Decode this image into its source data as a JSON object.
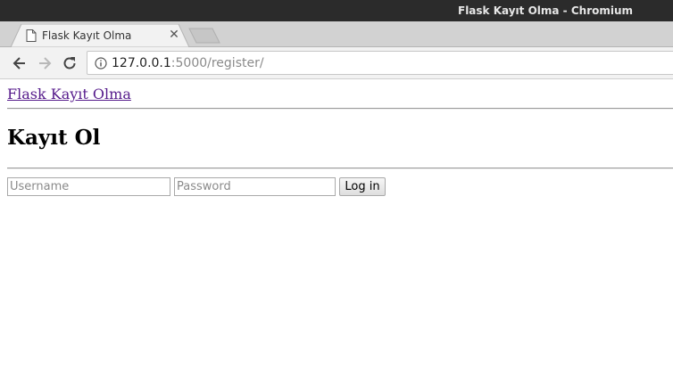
{
  "window": {
    "title": "Flask Kayıt Olma - Chromium"
  },
  "tabs": [
    {
      "title": "Flask Kayıt Olma",
      "icon": "page-icon",
      "active": true
    }
  ],
  "toolbar": {
    "back_icon": "back-arrow-icon",
    "forward_icon": "forward-arrow-icon",
    "reload_icon": "reload-icon",
    "info_icon": "info-icon",
    "url_host": "127.0.0.1",
    "url_rest": ":5000/register/"
  },
  "page": {
    "brand_link": "Flask Kayıt Olma",
    "heading": "Kayıt Ol",
    "form": {
      "username_placeholder": "Username",
      "password_placeholder": "Password",
      "submit_label": "Log in"
    }
  },
  "colors": {
    "titlebar_bg": "#2b2b2b",
    "tabstrip_bg": "#d2d2d2",
    "visited_link": "#551a8b"
  }
}
